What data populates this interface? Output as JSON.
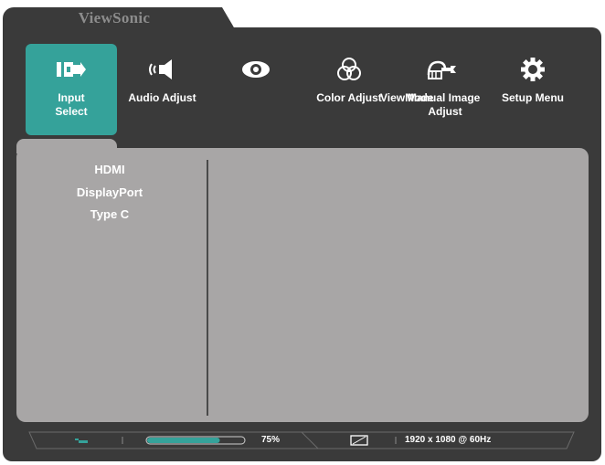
{
  "brand": "ViewSonic",
  "menu": [
    {
      "id": "input-select",
      "label_line1": "Input",
      "label_line2": "Select",
      "active": true
    },
    {
      "id": "audio-adjust",
      "label_line1": "Audio Adjust",
      "label_line2": ""
    },
    {
      "id": "viewmode",
      "label_line1": "",
      "label_line2": ""
    },
    {
      "id": "color-adjust",
      "label_line1": "Color Adjust",
      "label_line2": ""
    },
    {
      "id": "manual-image-adjust",
      "label_line1": "ViewMode",
      "label_line2": ""
    },
    {
      "id": "manual-image-adjust-2",
      "label_line1": "Manual Image",
      "label_line2": "Adjust"
    },
    {
      "id": "setup-menu",
      "label_line1": "Setup Menu",
      "label_line2": ""
    }
  ],
  "submenu": [
    "HDMI",
    "DisplayPort",
    "Type C"
  ],
  "status": {
    "progress_value": 75,
    "progress_label": "75%",
    "resolution": "1920 x 1080 @ 60Hz"
  },
  "colors": {
    "frame": "#3a3a3a",
    "accent": "#35a29a",
    "panel": "#a8a6a6"
  }
}
